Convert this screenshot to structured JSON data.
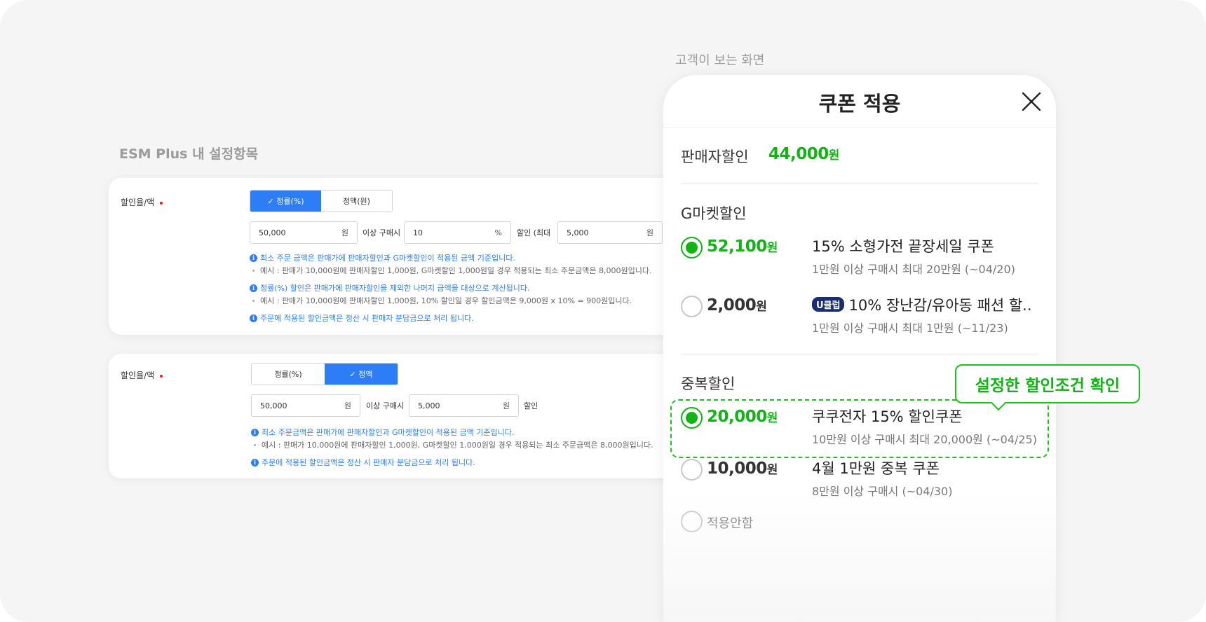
{
  "labels": {
    "esm_section": "ESM Plus 내 설정항목",
    "customer_section": "고객이 보는 화면"
  },
  "esm": {
    "card1": {
      "field_label": "할인율/액",
      "seg_rate": "✓ 정률(%)",
      "seg_amount": "정액(원)",
      "min_value": "50,000",
      "min_unit": "원",
      "above_text": "이상 구매시",
      "rate_value": "10",
      "rate_unit": "%",
      "discount_max_text": "할인  (최대",
      "max_value": "5,000",
      "max_unit": "원",
      "note1": "최소 주문 금액은 판매가에 판매자할인과 G마켓할인이 적용된 금액 기준입니다.",
      "note1_sub": "예시 : 판매가 10,000원에 판매자할인 1,000원, G마켓할인 1,000원일 경우 적용되는 최소 주문금액은 8,000원입니다.",
      "note2": "정률(%) 할인은 판매가에 판매자할인을 제외한 나머지 금액을 대상으로 계산됩니다.",
      "note2_sub": "예시 : 판매가 10,000원에 판매자할인 1,000원, 10% 할인일 경우 할인금액은 9,000원 x 10% = 900원입니다.",
      "note3": "주문에 적용된 할인금액은 정산 시 판매자 분담금으로 처리 됩니다."
    },
    "card2": {
      "field_label": "할인율/액",
      "seg_rate": "정률(%)",
      "seg_amount": "✓ 정액",
      "min_value": "50,000",
      "min_unit": "원",
      "above_text": "이상 구매시",
      "amount_value": "5,000",
      "amount_unit": "원",
      "discount_text": "할인",
      "note1": "최소 주문금액은 판매가에 판매자할인과 G마켓할인이 적용된 금액 기준입니다.",
      "note1_sub": "예시 : 판매가 10,000원에 판매자할인 1,000원, G마켓할인 1,000원일 경우 적용되는 최소 주문금액은 8,000원입니다.",
      "note2": "주문에 적용된 할인금액은 정산 시 판매자 분담금으로 처리 됩니다."
    }
  },
  "customer": {
    "title": "쿠폰 적용",
    "seller_discount_label": "판매자할인",
    "seller_discount_amount": "44,000",
    "won": "원",
    "gmarket_section": "G마켓할인",
    "gmarket_coupons": [
      {
        "amount": "52,100",
        "name": "15% 소형가전 끝장세일 쿠폰",
        "desc": "1만원 이상 구매시 최대 20만원 (~04/20)",
        "selected": true
      },
      {
        "amount": "2,000",
        "badge": "U클럽",
        "name": "10% 장난감/유아동 패션 할..",
        "desc": "1만원 이상 구매시 최대 1만원 (~11/23)",
        "selected": false
      }
    ],
    "dup_section": "중복할인",
    "dup_coupons": [
      {
        "amount": "20,000",
        "name": "쿠쿠전자 15% 할인쿠폰",
        "desc": "10만원 이상 구매시 최대 20,000원 (~04/25)",
        "selected": true
      },
      {
        "amount": "10,000",
        "name": "4월 1만원 중복 쿠폰",
        "desc": "8만원 이상 구매시 (~04/30)",
        "selected": false
      }
    ],
    "no_apply": "적용안함",
    "tooltip": "설정한 할인조건 확인"
  },
  "colors": {
    "accent_green": "#12b315",
    "accent_blue": "#2d7df6"
  }
}
